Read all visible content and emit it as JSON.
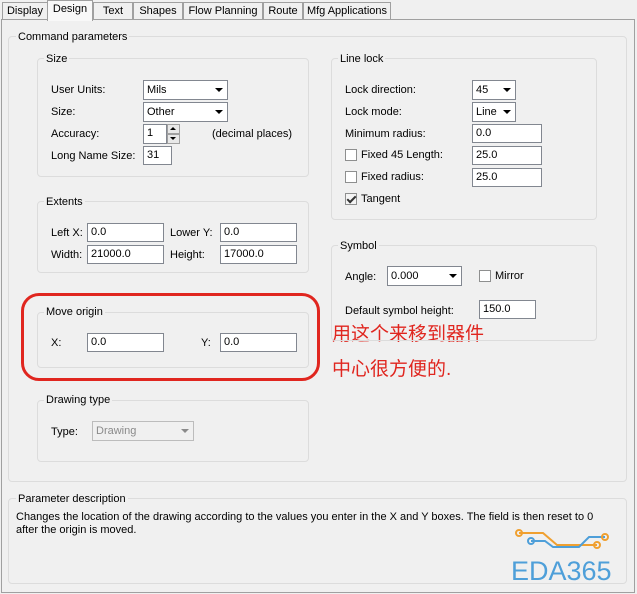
{
  "tabs": [
    {
      "label": "Display"
    },
    {
      "label": "Design"
    },
    {
      "label": "Text"
    },
    {
      "label": "Shapes"
    },
    {
      "label": "Flow Planning"
    },
    {
      "label": "Route"
    },
    {
      "label": "Mfg Applications"
    }
  ],
  "command_parameters": {
    "title": "Command parameters",
    "size": {
      "title": "Size",
      "user_units_label": "User Units:",
      "user_units_value": "Mils",
      "size_label": "Size:",
      "size_value": "Other",
      "accuracy_label": "Accuracy:",
      "accuracy_value": "1",
      "accuracy_hint": "(decimal places)",
      "long_name_label": "Long Name Size:",
      "long_name_value": "31"
    },
    "extents": {
      "title": "Extents",
      "left_x_label": "Left X:",
      "left_x_value": "0.0",
      "lower_y_label": "Lower Y:",
      "lower_y_value": "0.0",
      "width_label": "Width:",
      "width_value": "21000.0",
      "height_label": "Height:",
      "height_value": "17000.0"
    },
    "move_origin": {
      "title": "Move origin",
      "x_label": "X:",
      "x_value": "0.0",
      "y_label": "Y:",
      "y_value": "0.0"
    },
    "drawing_type": {
      "title": "Drawing type",
      "type_label": "Type:",
      "type_value": "Drawing"
    },
    "line_lock": {
      "title": "Line lock",
      "lock_direction_label": "Lock direction:",
      "lock_direction_value": "45",
      "lock_mode_label": "Lock mode:",
      "lock_mode_value": "Line",
      "min_radius_label": "Minimum radius:",
      "min_radius_value": "0.0",
      "fixed45_label": "Fixed 45 Length:",
      "fixed45_checked": false,
      "fixed45_value": "25.0",
      "fixed_radius_label": "Fixed radius:",
      "fixed_radius_checked": false,
      "fixed_radius_value": "25.0",
      "tangent_label": "Tangent",
      "tangent_checked": true
    },
    "symbol": {
      "title": "Symbol",
      "angle_label": "Angle:",
      "angle_value": "0.000",
      "mirror_label": "Mirror",
      "mirror_checked": false,
      "default_height_label": "Default symbol height:",
      "default_height_value": "150.0"
    }
  },
  "annotation": {
    "line1": "用这个来移到器件",
    "line2": "中心很方便的.",
    "color": "#e0261f"
  },
  "parameter_description": {
    "title": "Parameter description",
    "line1": "Changes the location of the drawing according to the values you enter in the X and Y boxes. The field is then reset to 0",
    "line2": "after the origin is moved."
  },
  "watermark": {
    "text": "EDA365",
    "color": "#4e9fd9"
  }
}
